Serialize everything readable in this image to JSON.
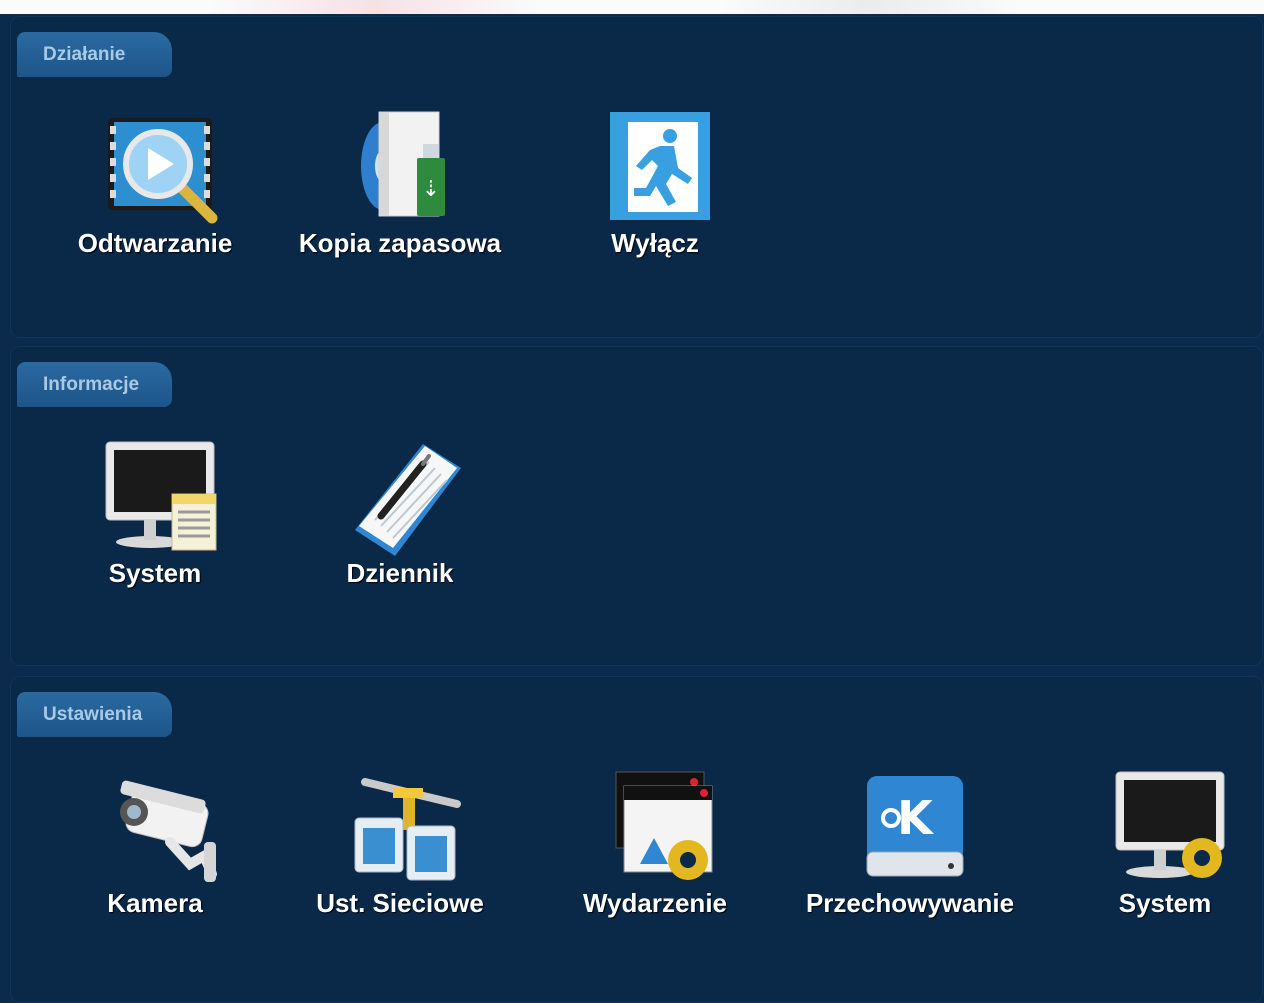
{
  "sections": [
    {
      "title": "Działanie",
      "items": [
        {
          "label": "Odtwarzanie",
          "icon": "playback-icon"
        },
        {
          "label": "Kopia zapasowa",
          "icon": "backup-icon"
        },
        {
          "label": "Wyłącz",
          "icon": "exit-icon"
        }
      ]
    },
    {
      "title": "Informacje",
      "items": [
        {
          "label": "System",
          "icon": "system-info-icon"
        },
        {
          "label": "Dziennik",
          "icon": "log-notebook-icon"
        }
      ]
    },
    {
      "title": "Ustawienia",
      "items": [
        {
          "label": "Kamera",
          "icon": "camera-icon"
        },
        {
          "label": "Ust. Sieciowe",
          "icon": "network-icon"
        },
        {
          "label": "Wydarzenie",
          "icon": "event-settings-icon"
        },
        {
          "label": "Przechowywanie",
          "icon": "storage-icon"
        },
        {
          "label": "System",
          "icon": "system-settings-icon"
        }
      ]
    }
  ],
  "colors": {
    "background": "#0b2a4c",
    "tab": "#1d5589",
    "tab_text": "#a9c9e6",
    "label_text": "#ffffff"
  }
}
